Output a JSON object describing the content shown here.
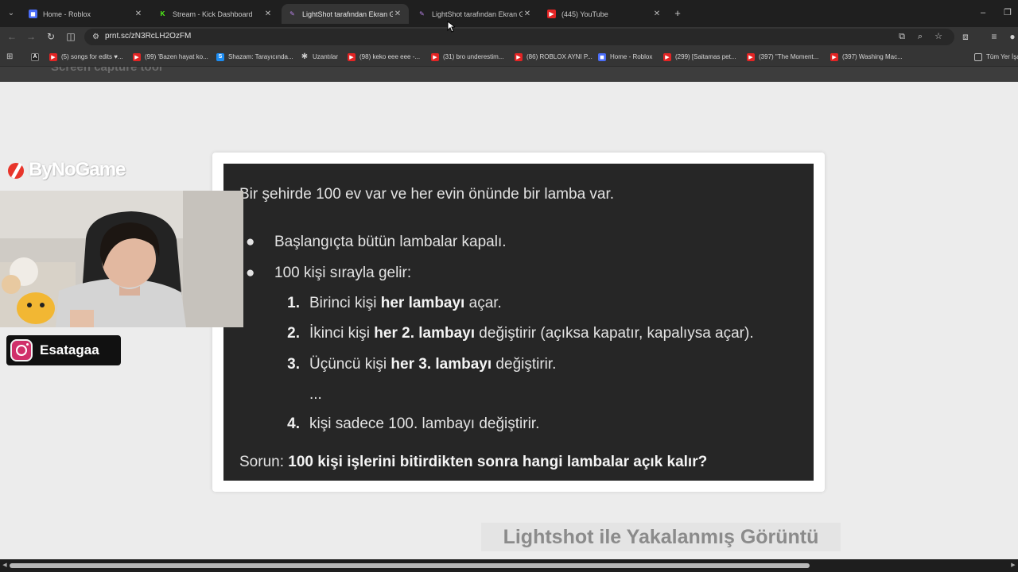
{
  "browser": {
    "tabs": [
      {
        "title": "Home - Roblox",
        "color": "#4a6cf7",
        "glyph": "◼",
        "active": false
      },
      {
        "title": "Stream - Kick Dashboard",
        "color": "#53fc18",
        "glyph": "K",
        "active": false
      },
      {
        "title": "LightShot tarafından Ekran Görü",
        "color": "#9b59d0",
        "glyph": "✎",
        "active": true
      },
      {
        "title": "LightShot tarafından Ekran Görü",
        "color": "#9b59d0",
        "glyph": "✎",
        "active": false
      },
      {
        "title": "(445) YouTube",
        "color": "#e32424",
        "glyph": "▶",
        "active": false
      }
    ],
    "new_tab_glyph": "+",
    "url": "prnt.sc/zN3RcLH2OzFM",
    "bookmarks": [
      {
        "label": "(5) songs for edits ♥...",
        "color": "#e32424",
        "glyph": "▶"
      },
      {
        "label": "(99) 'Bazen hayat ko...",
        "color": "#e32424",
        "glyph": "▶"
      },
      {
        "label": "Shazam: Tarayıcında...",
        "color": "#1c8cf2",
        "glyph": "S"
      },
      {
        "label": "Uzantılar",
        "color": "#777777",
        "glyph": "✱"
      },
      {
        "label": "(98) keko eee eee -...",
        "color": "#e32424",
        "glyph": "▶"
      },
      {
        "label": "(31) bro underestim...",
        "color": "#e32424",
        "glyph": "▶"
      },
      {
        "label": "(86) ROBLOX AYNI P...",
        "color": "#e32424",
        "glyph": "▶"
      },
      {
        "label": "Home - Roblox",
        "color": "#4a6cf7",
        "glyph": "◼"
      },
      {
        "label": "(299) [Saitamas pet...",
        "color": "#e32424",
        "glyph": "▶"
      },
      {
        "label": "(397) \"The Moment...",
        "color": "#e32424",
        "glyph": "▶"
      },
      {
        "label": "(397) Washing Mac...",
        "color": "#e32424",
        "glyph": "▶"
      }
    ],
    "all_bookmarks_label": "Tüm Yer İşaretleri"
  },
  "overlay": {
    "brand": "ByNoGame",
    "social_handle": "Esatagaa"
  },
  "screenshot": {
    "intro": "Bir şehirde 100 ev var ve her evin önünde bir lamba var.",
    "bullets": [
      "Başlangıçta bütün lambalar kapalı.",
      "100 kişi sırayla gelir:"
    ],
    "steps": [
      {
        "num": "1.",
        "pre": "Birinci kişi ",
        "bold": "her lambayı",
        "post": " açar."
      },
      {
        "num": "2.",
        "pre": "İkinci kişi ",
        "bold": "her 2. lambayı",
        "post": " değiştirir (açıksa kapatır, kapalıysa açar)."
      },
      {
        "num": "3.",
        "pre": "Üçüncü kişi ",
        "bold": "her 3. lambayı",
        "post": " değiştirir."
      },
      {
        "num": "",
        "pre": "...",
        "bold": "",
        "post": ""
      },
      {
        "num": "4.",
        "pre": "kişi sadece 100. lambayı değiştirir.",
        "bold": "",
        "post": ""
      }
    ],
    "question_label": "Sorun: ",
    "question": "100 kişi işlerini bitirdikten sonra hangi lambalar açık kalır?"
  },
  "watermark": "Lightshot ile Yakalanmış Görüntü"
}
